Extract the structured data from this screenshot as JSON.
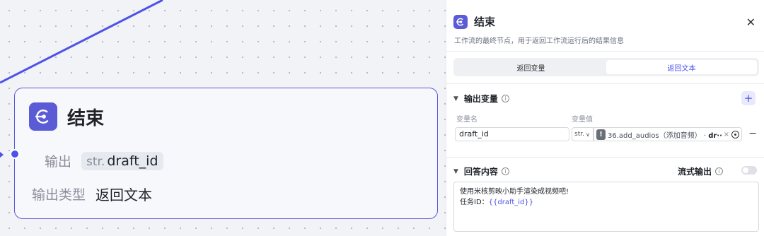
{
  "node": {
    "title": "结束",
    "output_label": "输出",
    "output_type_tag": "str.",
    "output_var": "draft_id",
    "output_type_label": "输出类型",
    "output_type_value": "返回文本"
  },
  "panel": {
    "title": "结束",
    "description": "工作流的最终节点，用于返回工作流运行后的结果信息",
    "tabs": [
      {
        "label": "返回变量",
        "active": false
      },
      {
        "label": "返回文本",
        "active": true
      }
    ],
    "output_section": {
      "title": "输出变量",
      "col_name": "变量名",
      "col_value": "变量值",
      "row": {
        "name": "draft_id",
        "type": "str.",
        "ref_icon": "!",
        "ref_prefix": "36.add_audios（添加音频）",
        "ref_sep": " · ",
        "ref_field": "dr···"
      }
    },
    "answer_section": {
      "title": "回答内容",
      "stream_label": "流式输出",
      "stream_on": false,
      "line1": "使用米核剪映小助手渲染成视频吧!",
      "line2_prefix": "任务ID：",
      "line2_var": "{{draft_id}}"
    }
  },
  "colors": {
    "accent": "#4d53e8",
    "node_border": "#5b5bd6",
    "canvas_bg": "#f2f3f7"
  }
}
